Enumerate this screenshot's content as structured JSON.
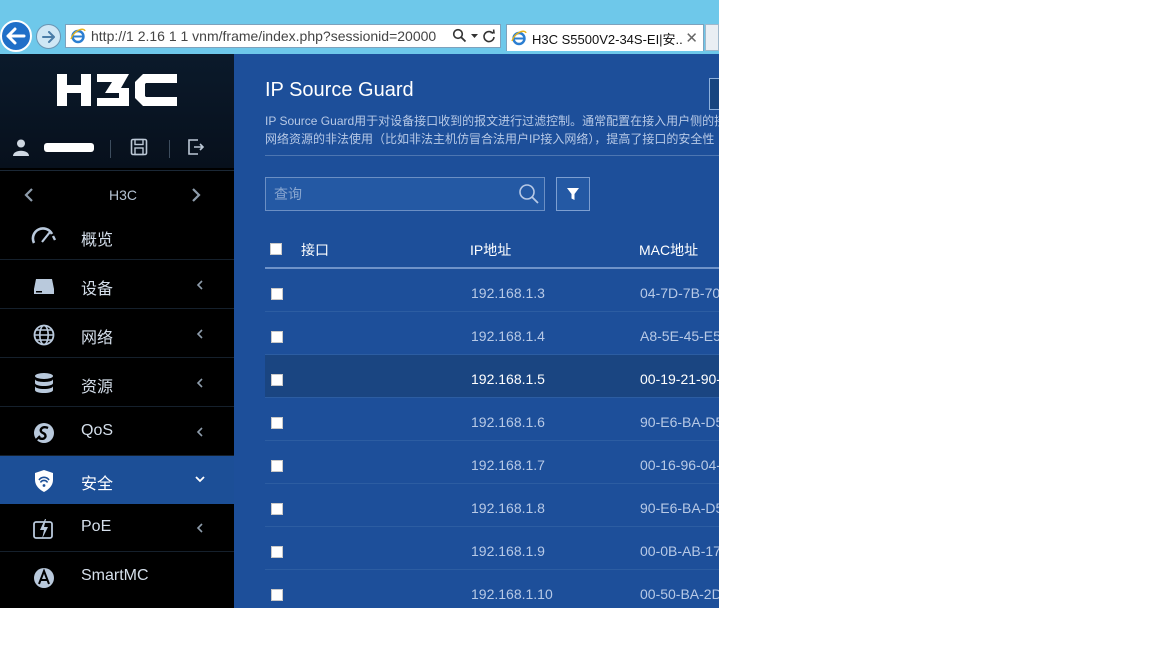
{
  "browser": {
    "address": "http://1 2.16 1 1     vnm/frame/index.php?sessionid=20000",
    "tab_title": "H3C S5500V2-34S-EI|安...",
    "tab_close": "✕"
  },
  "sidebar": {
    "logo_text": "H3C",
    "device_name": "H3C",
    "menu": [
      {
        "label": "概览",
        "icon": "dashboard-gauge-icon",
        "has_submenu": false
      },
      {
        "label": "设备",
        "icon": "device-icon",
        "has_submenu": true
      },
      {
        "label": "网络",
        "icon": "globe-icon",
        "has_submenu": true
      },
      {
        "label": "资源",
        "icon": "database-icon",
        "has_submenu": true
      },
      {
        "label": "QoS",
        "icon": "qos-icon",
        "has_submenu": true
      },
      {
        "label": "安全",
        "icon": "shield-icon",
        "has_submenu": true,
        "active": true
      },
      {
        "label": "PoE",
        "icon": "poe-lightning-icon",
        "has_submenu": true
      },
      {
        "label": "SmartMC",
        "icon": "smartmc-icon",
        "has_submenu": false
      }
    ]
  },
  "main": {
    "title": "IP Source Guard",
    "desc_line1": "IP Source Guard用于对设备接口收到的报文进行过滤控制。通常配置在接入用户侧的接",
    "desc_line2": "网络资源的非法使用（比如非法主机仿冒合法用户IP接入网络），提高了接口的安全性",
    "search_placeholder": "查询",
    "table": {
      "columns": [
        "接口",
        "IP地址",
        "MAC地址"
      ],
      "rows": [
        {
          "interface": "",
          "ip": "192.168.1.3",
          "mac": "04-7D-7B-70"
        },
        {
          "interface": "",
          "ip": "192.168.1.4",
          "mac": "A8-5E-45-E5"
        },
        {
          "interface": "",
          "ip": "192.168.1.5",
          "mac": "00-19-21-90-",
          "selected": true
        },
        {
          "interface": "",
          "ip": "192.168.1.6",
          "mac": "90-E6-BA-D5"
        },
        {
          "interface": "",
          "ip": "192.168.1.7",
          "mac": "00-16-96-04-"
        },
        {
          "interface": "",
          "ip": "192.168.1.8",
          "mac": "90-E6-BA-D5"
        },
        {
          "interface": "",
          "ip": "192.168.1.9",
          "mac": "00-0B-AB-17"
        },
        {
          "interface": "",
          "ip": "192.168.1.10",
          "mac": "00-50-BA-2D"
        }
      ]
    }
  },
  "colors": {
    "main_bg": "#1d4f9a",
    "sidebar_bg": "#000000",
    "active_menu": "#1c4f97",
    "browser_chrome": "#6ec8ea"
  }
}
